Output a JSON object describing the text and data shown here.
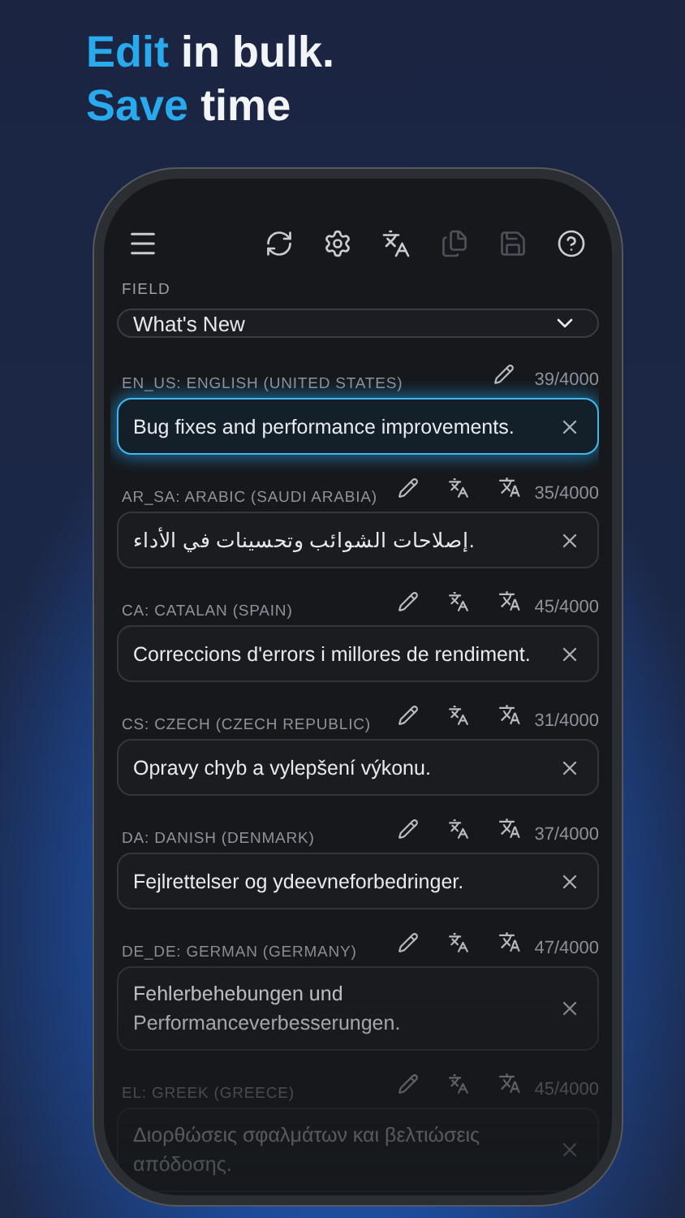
{
  "headline": [
    [
      {
        "text": "Edit",
        "accent": true
      },
      {
        "text": " in bulk.",
        "accent": false
      }
    ],
    [
      {
        "text": "Save",
        "accent": true
      },
      {
        "text": " time",
        "accent": false
      }
    ]
  ],
  "toolbar": [
    {
      "kind": "menu",
      "disabled": false
    },
    {
      "kind": "refresh",
      "disabled": false
    },
    {
      "kind": "settings",
      "disabled": false
    },
    {
      "kind": "translate",
      "disabled": false
    },
    {
      "kind": "copy",
      "disabled": true
    },
    {
      "kind": "save",
      "disabled": true
    },
    {
      "kind": "help",
      "disabled": false
    }
  ],
  "field": {
    "label": "FIELD",
    "value": "What's New"
  },
  "rows": [
    {
      "kind": "source",
      "locale": "EN_US: ENGLISH (UNITED STATES)",
      "count": "39/4000",
      "text": "Bug fixes and performance improvements.",
      "selected": true
    },
    {
      "kind": "target",
      "locale": "AR_SA: ARABIC (SAUDI ARABIA)",
      "count": "35/4000",
      "text": "إصلاحات الشوائب وتحسينات في الأداء.",
      "selected": false
    },
    {
      "kind": "target",
      "locale": "CA: CATALAN (SPAIN)",
      "count": "45/4000",
      "text": "Correccions d'errors i millores de rendiment.",
      "selected": false
    },
    {
      "kind": "target",
      "locale": "CS: CZECH (CZECH REPUBLIC)",
      "count": "31/4000",
      "text": "Opravy chyb a vylepšení výkonu.",
      "selected": false
    },
    {
      "kind": "target",
      "locale": "DA: DANISH (DENMARK)",
      "count": "37/4000",
      "text": "Fejlrettelser og ydeevneforbedringer.",
      "selected": false
    },
    {
      "kind": "target",
      "locale": "DE_DE: GERMAN (GERMANY)",
      "count": "47/4000",
      "text": "Fehlerbehebungen und Performanceverbesserungen.",
      "selected": false
    },
    {
      "kind": "target",
      "locale": "EL: GREEK (GREECE)",
      "count": "45/4000",
      "text": "Διορθώσεις σφαλμάτων και βελτιώσεις απόδοσης.",
      "selected": false
    }
  ]
}
